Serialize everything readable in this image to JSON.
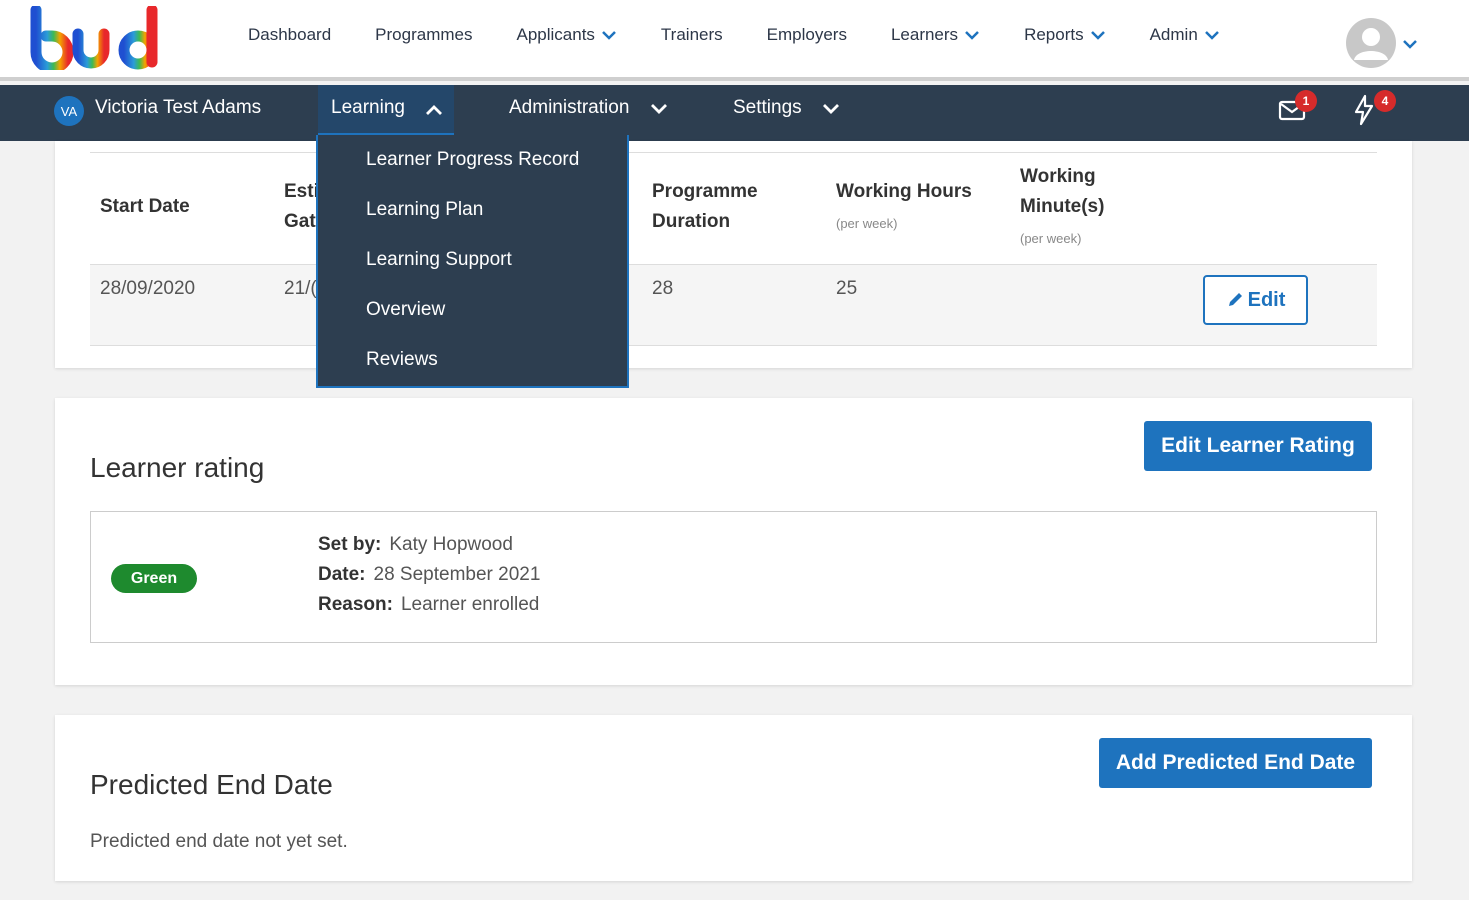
{
  "topnav": {
    "items": [
      {
        "label": "Dashboard",
        "dropdown": false
      },
      {
        "label": "Programmes",
        "dropdown": false
      },
      {
        "label": "Applicants",
        "dropdown": true
      },
      {
        "label": "Trainers",
        "dropdown": false
      },
      {
        "label": "Employers",
        "dropdown": false
      },
      {
        "label": "Learners",
        "dropdown": true
      },
      {
        "label": "Reports",
        "dropdown": true
      },
      {
        "label": "Admin",
        "dropdown": true
      }
    ]
  },
  "subnav": {
    "initials": "VA",
    "learner_name": "Victoria Test Adams",
    "learning": "Learning",
    "administration": "Administration",
    "settings": "Settings",
    "mail_count": "1",
    "alerts_count": "4"
  },
  "dropdown": {
    "items": [
      "Learner Progress Record",
      "Learning Plan",
      "Learning Support",
      "Overview",
      "Reviews"
    ]
  },
  "programme_table": {
    "headers": {
      "start_date": "Start Date",
      "est_line1": "Esti",
      "est_line2": "Gat",
      "duration_line1": "Programme",
      "duration_line2": "Duration",
      "hours": "Working Hours",
      "hours_sub": "(per week)",
      "minutes_line1": "Working",
      "minutes_line2": "Minute(s)",
      "minutes_sub": "(per week)"
    },
    "row": {
      "start_date": "28/09/2020",
      "est_gateway": "21/(",
      "duration": "28",
      "hours": "25"
    },
    "edit_label": "Edit"
  },
  "learner_rating": {
    "title": "Learner rating",
    "button": "Edit Learner Rating",
    "status": "Green",
    "status_color": "#1e8a2e",
    "set_by_label": "Set by:",
    "set_by": "Katy Hopwood",
    "date_label": "Date:",
    "date": "28 September 2021",
    "reason_label": "Reason:",
    "reason": "Learner enrolled"
  },
  "predicted_end": {
    "title": "Predicted End Date",
    "button": "Add Predicted End Date",
    "note": "Predicted end date not yet set."
  },
  "colors": {
    "accent": "#1e73be",
    "navbar": "#2d3e50",
    "badge": "#d62b2b"
  }
}
